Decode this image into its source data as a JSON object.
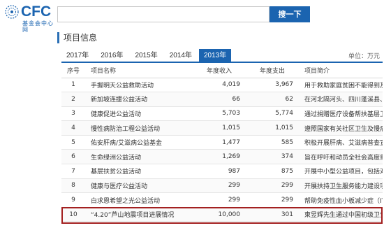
{
  "logo": {
    "text": "CFC",
    "subtitle": "基金会中心网"
  },
  "search": {
    "value": "",
    "placeholder": "",
    "button_label": "搜一下"
  },
  "section": {
    "title": "项目信息"
  },
  "tabs": [
    {
      "label": "2017年",
      "active": false
    },
    {
      "label": "2016年",
      "active": false
    },
    {
      "label": "2015年",
      "active": false
    },
    {
      "label": "2014年",
      "active": false
    },
    {
      "label": "2013年",
      "active": true
    }
  ],
  "unit_label": "单位：万元",
  "table": {
    "headers": [
      "序号",
      "项目名称",
      "年度收入",
      "年度支出",
      "项目简介"
    ],
    "rows": [
      [
        "1",
        "手握明天公益救助活动",
        "4,019",
        "3,967",
        "用于救助家庭贫困不能得到及"
      ],
      [
        "2",
        "新加坡连援公益活动",
        "66",
        "62",
        "在河北隔河头、四川蓬溪县、"
      ],
      [
        "3",
        "健康促进公益活动",
        "5,703",
        "5,774",
        "通过捐赠医疗设备帮扶基层卫"
      ],
      [
        "4",
        "慢性病防治工程公益活动",
        "1,015",
        "1,015",
        "遵照国家有关社区卫生及慢病"
      ],
      [
        "5",
        "佑安肝病/艾滋病公益基金",
        "1,477",
        "585",
        "积极开展肝病、艾滋病普查宣"
      ],
      [
        "6",
        "生命绿洲公益活动",
        "1,269",
        "374",
        "旨在呼吁和动员全社会高度重"
      ],
      [
        "7",
        "基层扶贫公益活动",
        "987",
        "875",
        "开展中小型公益项目，包括对"
      ],
      [
        "8",
        "健康与医疗公益活动",
        "299",
        "299",
        "开展扶持卫生服务能力建设项"
      ],
      [
        "9",
        "白求恩希望之光公益活动",
        "299",
        "299",
        "帮助免疫性血小板减少症（ITP"
      ],
      [
        "10",
        "“4.20”芦山地震项目进展情况",
        "10,000",
        "301",
        "柬昱辉先生通过中国初级卫生"
      ]
    ]
  },
  "colors": {
    "brand": "#1b64b0",
    "highlight_border": "#a32020"
  }
}
